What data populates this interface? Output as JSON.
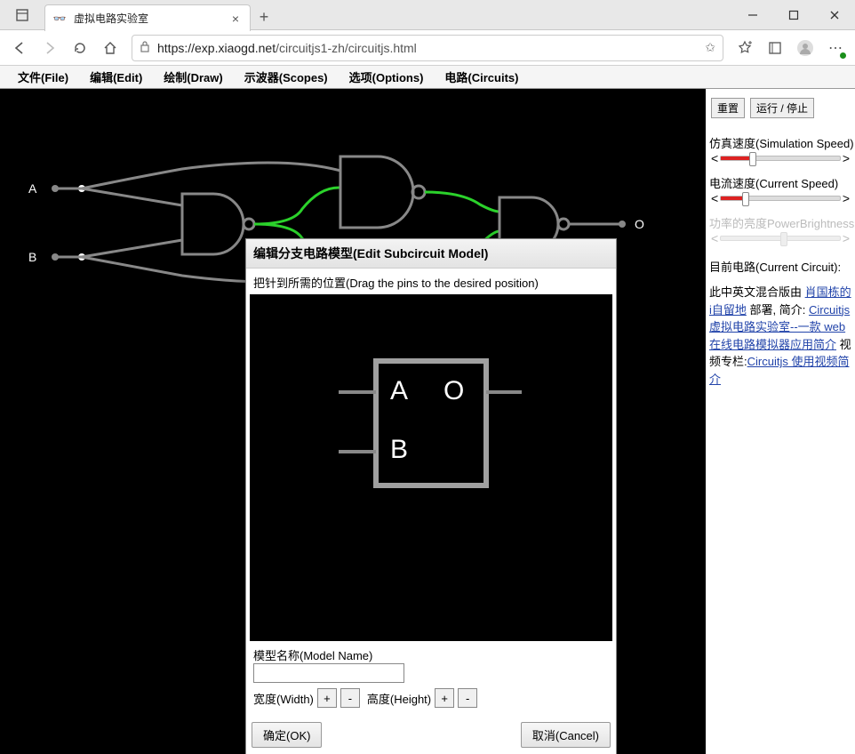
{
  "browser": {
    "tab_title": "虚拟电路实验室",
    "url_host": "https://exp.xiaogd.net",
    "url_path": "/circuitjs1-zh/circuitjs.html",
    "close_glyph": "×",
    "newtab_glyph": "+",
    "min_glyph": "—",
    "max_glyph": "▢",
    "x_glyph": "✕"
  },
  "menubar": {
    "file": "文件(File)",
    "edit": "编辑(Edit)",
    "draw": "绘制(Draw)",
    "scopes": "示波器(Scopes)",
    "options": "选项(Options)",
    "circuits": "电路(Circuits)"
  },
  "canvas": {
    "labelA": "A",
    "labelB": "B",
    "labelO": "O"
  },
  "sidebar": {
    "reset_label": "重置",
    "run_label": "运行 / 停止",
    "sim_speed_label": "仿真速度(Simulation Speed)",
    "current_speed_label": "电流速度(Current Speed)",
    "brightness_label": "功率的亮度PowerBrightness",
    "current_circuit_label": "目前电路(Current Circuit):",
    "para_pre": "此中英文混合版由 ",
    "link1": "肖国栋的i自留地",
    "para_mid1": " 部署, 简介: ",
    "link2": "Circuitjs 虚拟电路实验室--一款 web 在线电路模拟器应用简介",
    "para_mid2": " 视频专栏:",
    "link3": "Circuitjs 使用视频简介"
  },
  "dialog": {
    "title": "编辑分支电路模型(Edit Subcircuit Model)",
    "hint": "把针到所需的位置(Drag the pins to the desired position)",
    "pinA": "A",
    "pinB": "B",
    "pinO": "O",
    "model_name_label": "模型名称(Model Name)",
    "model_name_value": "",
    "width_label": "宽度(Width)",
    "height_label": "高度(Height)",
    "plus": "+",
    "minus": "-",
    "ok_label": "确定(OK)",
    "cancel_label": "取消(Cancel)"
  }
}
